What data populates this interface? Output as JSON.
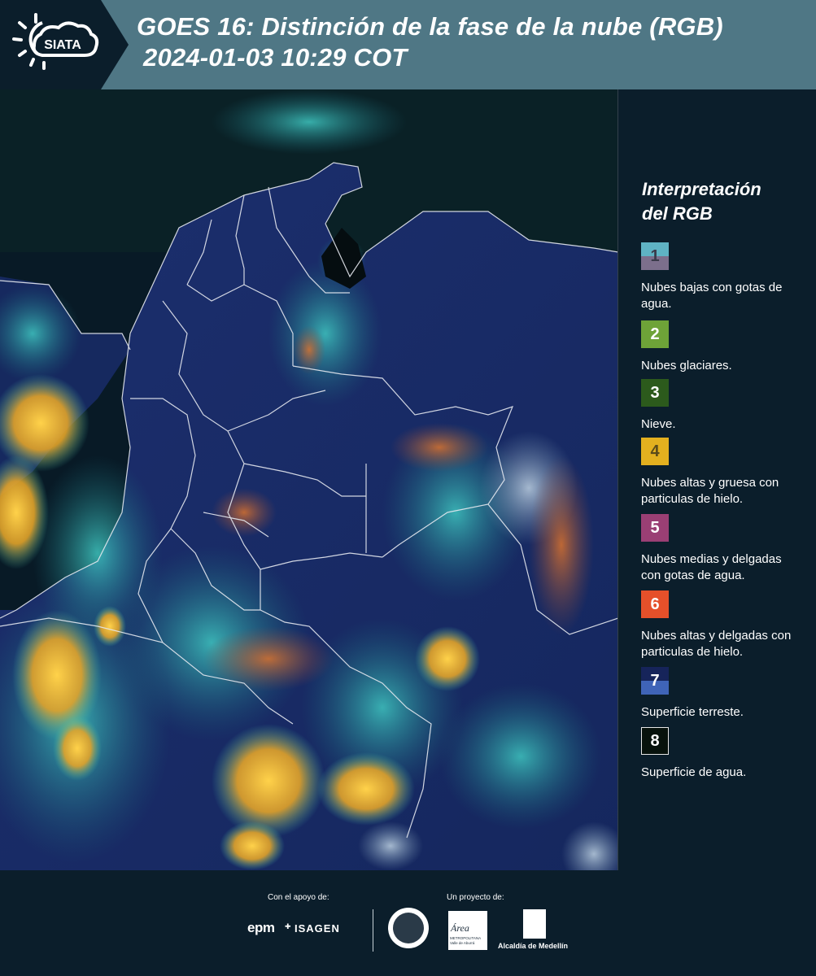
{
  "header": {
    "logo_text": "SIATA",
    "title_line1": "GOES 16: Distinción de la fase de la nube (RGB)",
    "title_line2": "2024-01-03 10:29 COT"
  },
  "colors": {
    "header_bg": "#4f7785",
    "logo_bg": "#0b1e2b",
    "legend_bg": "#0b1e2b"
  },
  "legend": {
    "title_line1": "Interpretación",
    "title_line2": "del RGB",
    "items": [
      {
        "number": "1",
        "label": "Nubes bajas con gotas de agua.",
        "color_top": "#5fb3c4",
        "color_bottom": "#7c6f8c"
      },
      {
        "number": "2",
        "label": "Nubes glaciares.",
        "color_top": "#6ea338",
        "color_bottom": "#6ea338"
      },
      {
        "number": "3",
        "label": "Nieve.",
        "color_top": "#2c5a1c",
        "color_bottom": "#2c5a1c"
      },
      {
        "number": "4",
        "label": "Nubes altas y gruesa con particulas de hielo.",
        "color_top": "#e3b01f",
        "color_bottom": "#e3b01f"
      },
      {
        "number": "5",
        "label": "Nubes medias y delgadas con gotas de agua.",
        "color_top": "#9a3f74",
        "color_bottom": "#9a3f74"
      },
      {
        "number": "6",
        "label": "Nubes altas y delgadas con particulas de hielo.",
        "color_top": "#e5502a",
        "color_bottom": "#e5502a"
      },
      {
        "number": "7",
        "label": "Superficie terreste.",
        "color_top": "#16245a",
        "color_bottom": "#3f64b8"
      },
      {
        "number": "8",
        "label": "Superficie de agua.",
        "color_top": "#07120c",
        "color_bottom": "#07120c"
      }
    ]
  },
  "footer": {
    "support_label": "Con el apoyo de:",
    "project_label": "Un proyecto de:",
    "epm": "epm",
    "isagen": "ISAGEN",
    "area_logo": "Área",
    "area_sub": "METROPOLITANA Valle de Aburrá",
    "medellin": "Alcaldía de Medellín"
  }
}
